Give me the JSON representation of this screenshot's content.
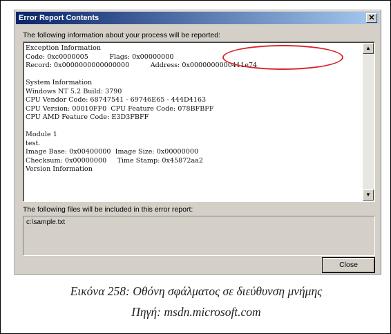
{
  "window": {
    "title": "Error Report Contents",
    "close_glyph": "✕",
    "process_label": "The following information about your process will be reported:",
    "report_text": "Exception Information\nCode: 0xc0000005          Flags: 0x00000000\nRecord: 0x0000000000000000          Address: 0x0000000000411e74\n\nSystem Information\nWindows NT 5.2 Build: 3790\nCPU Vendor Code: 68747541 - 69746E65 - 444D4163\nCPU Version: 00010FF0  CPU Feature Code: 078BFBFF\nCPU AMD Feature Code: E3D3FBFF\n\nModule 1\ntest.\nImage Base: 0x00400000  Image Size: 0x00000000\nChecksum: 0x00000000     Time Stamp: 0x45872aa2\nVersion Information",
    "files_label": "The following files will be included in this error report:",
    "files_list": "c:\\sample.txt",
    "close_button_label": "Close",
    "scroll_up_glyph": "▲",
    "scroll_down_glyph": "▼"
  },
  "caption": {
    "line1": "Εικόνα 258: Οθόνη σφάλματος σε διεύθυνση μνήμης",
    "line2": "Πηγή: msdn.microsoft.com"
  },
  "colors": {
    "title_bar_start": "#0a246a",
    "title_bar_end": "#a6caf0",
    "highlight_circle": "#d8232a",
    "dialog_face": "#d4d0c8"
  }
}
